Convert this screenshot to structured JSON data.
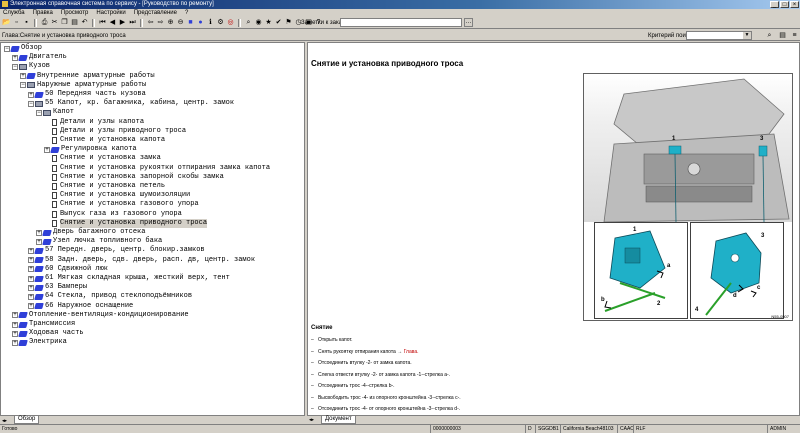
{
  "window": {
    "title": "Электронная справочная система по сервису - [Руководство по ремонту]"
  },
  "menubar": [
    "Служба",
    "Правка",
    "Просмотр",
    "Настройки",
    "Представление",
    "?"
  ],
  "toolbar": {
    "order_label": "Заметки к заказу:",
    "order_value": "",
    "icons": [
      "open-icon",
      "new-icon",
      "save-icon",
      "print-icon",
      "cut-icon",
      "copy-icon",
      "paste-icon",
      "undo-icon",
      "back-icon",
      "first-icon",
      "prev-icon",
      "next-icon",
      "last-icon",
      "forward-icon",
      "zoom-in-icon",
      "zoom-out-icon",
      "book-icon",
      "globe-icon",
      "info-icon",
      "gear-icon",
      "target-icon",
      "search-icon",
      "eye-icon",
      "star-icon",
      "check-icon",
      "flag-icon",
      "clock-icon",
      "lock-icon",
      "help-icon"
    ]
  },
  "pathbar": {
    "path": "Глава:Снятие и установка приводного троса",
    "criteria_label": "Критерий поиска:",
    "criteria_value": ""
  },
  "tree": [
    {
      "level": 0,
      "toggle": "-",
      "icon": "book",
      "label": "Обзор"
    },
    {
      "level": 1,
      "toggle": "+",
      "icon": "book",
      "label": "Двигатель"
    },
    {
      "level": 1,
      "toggle": "-",
      "icon": "folder",
      "label": "Кузов"
    },
    {
      "level": 2,
      "toggle": "+",
      "icon": "book",
      "label": "Внутренние арматурные работы"
    },
    {
      "level": 2,
      "toggle": "-",
      "icon": "folder",
      "label": "Наружные арматурные работы"
    },
    {
      "level": 3,
      "toggle": "+",
      "icon": "book",
      "label": "50 Передняя часть кузова"
    },
    {
      "level": 3,
      "toggle": "-",
      "icon": "folder",
      "label": "55 Капот, кр. багажника, кабина, центр. замок"
    },
    {
      "level": 4,
      "toggle": "-",
      "icon": "folder",
      "label": "Капот"
    },
    {
      "level": 5,
      "toggle": "",
      "icon": "doc",
      "label": "Детали и узлы капота"
    },
    {
      "level": 5,
      "toggle": "",
      "icon": "doc",
      "label": "Детали и узлы приводного троса"
    },
    {
      "level": 5,
      "toggle": "",
      "icon": "doc",
      "label": "Снятие и установка капота"
    },
    {
      "level": 5,
      "toggle": "+",
      "icon": "book",
      "label": "Регулировка капота"
    },
    {
      "level": 5,
      "toggle": "",
      "icon": "doc",
      "label": "Снятие и установка замка"
    },
    {
      "level": 5,
      "toggle": "",
      "icon": "doc",
      "label": "Снятие и установка рукоятки отпирания замка капота"
    },
    {
      "level": 5,
      "toggle": "",
      "icon": "doc",
      "label": "Снятие и установка запорной скобы замка"
    },
    {
      "level": 5,
      "toggle": "",
      "icon": "doc",
      "label": "Снятие и установка петель"
    },
    {
      "level": 5,
      "toggle": "",
      "icon": "doc",
      "label": "Снятие и установка шумоизоляции"
    },
    {
      "level": 5,
      "toggle": "",
      "icon": "doc",
      "label": "Снятие и установка газового упора"
    },
    {
      "level": 5,
      "toggle": "",
      "icon": "doc",
      "label": "Выпуск газа из газового упора"
    },
    {
      "level": 5,
      "toggle": "",
      "icon": "doc",
      "label": "Снятие и установка приводного троса",
      "selected": true
    },
    {
      "level": 4,
      "toggle": "+",
      "icon": "book",
      "label": "Дверь багажного отсека"
    },
    {
      "level": 4,
      "toggle": "+",
      "icon": "book",
      "label": "Узел лючка топливного бака"
    },
    {
      "level": 3,
      "toggle": "+",
      "icon": "book",
      "label": "57 Передн. дверь, центр. блокир.замков"
    },
    {
      "level": 3,
      "toggle": "+",
      "icon": "book",
      "label": "58 Задн. дверь, сдв. дверь, расп. дв, центр. замок"
    },
    {
      "level": 3,
      "toggle": "+",
      "icon": "book",
      "label": "60 Сдвижной люк"
    },
    {
      "level": 3,
      "toggle": "+",
      "icon": "book",
      "label": "61 Мягкая складная крыша, жесткий верх, тент"
    },
    {
      "level": 3,
      "toggle": "+",
      "icon": "book",
      "label": "63 Бамперы"
    },
    {
      "level": 3,
      "toggle": "+",
      "icon": "book",
      "label": "64 Стекла, привод стеклоподъёмников"
    },
    {
      "level": 3,
      "toggle": "+",
      "icon": "book",
      "label": "66 Наружное оснащение"
    },
    {
      "level": 1,
      "toggle": "+",
      "icon": "book",
      "label": "Отопление-вентиляция-кондиционирование"
    },
    {
      "level": 1,
      "toggle": "+",
      "icon": "book",
      "label": "Трансмиссия"
    },
    {
      "level": 1,
      "toggle": "+",
      "icon": "book",
      "label": "Ходовая часть"
    },
    {
      "level": 1,
      "toggle": "+",
      "icon": "book",
      "label": "Электрика"
    }
  ],
  "left_tabs": {
    "overview": "Обзор"
  },
  "right_tabs": {
    "document": "Документ"
  },
  "document": {
    "title": "Снятие и установка приводного троса",
    "figure": {
      "callouts_top": [
        "1",
        "3"
      ],
      "inset_left": [
        "1",
        "a",
        "b",
        "2"
      ],
      "inset_right": [
        "3",
        "c",
        "d",
        "4"
      ],
      "id": "N55-0507"
    },
    "section": "Снятие",
    "steps": [
      {
        "text": "Открыть капот."
      },
      {
        "text": "Снять рукоятку отпирания капота →",
        "link": "Глава."
      },
      {
        "text": "Отсоединить втулку -2- от замка капота."
      },
      {
        "text": "Слегка отвести втулку -2- от замка капота -1--стрелка a-."
      },
      {
        "text": "Отсоединить трос -4--стрелка b-."
      },
      {
        "text": "Высвободить трос -4- из опорного кронштейна -3--стрелка c-."
      },
      {
        "text": "Отсоединить трос -4- от опорного кронштейна -3--стрелка d-."
      }
    ]
  },
  "statusbar": {
    "status": "Готово",
    "order": "0000000003",
    "cell_d": "D",
    "cell_code": "SGGDB1",
    "cell_model": "California Beach48103",
    "cell_caac": "CAAC",
    "cell_rlf": "RLF",
    "user": "ADMIN"
  },
  "colors": {
    "accent_blue": "#2f3fd8",
    "highlight_teal": "#1fb0c8",
    "arrow_green": "#2aa02a",
    "link_red": "#c00000"
  }
}
